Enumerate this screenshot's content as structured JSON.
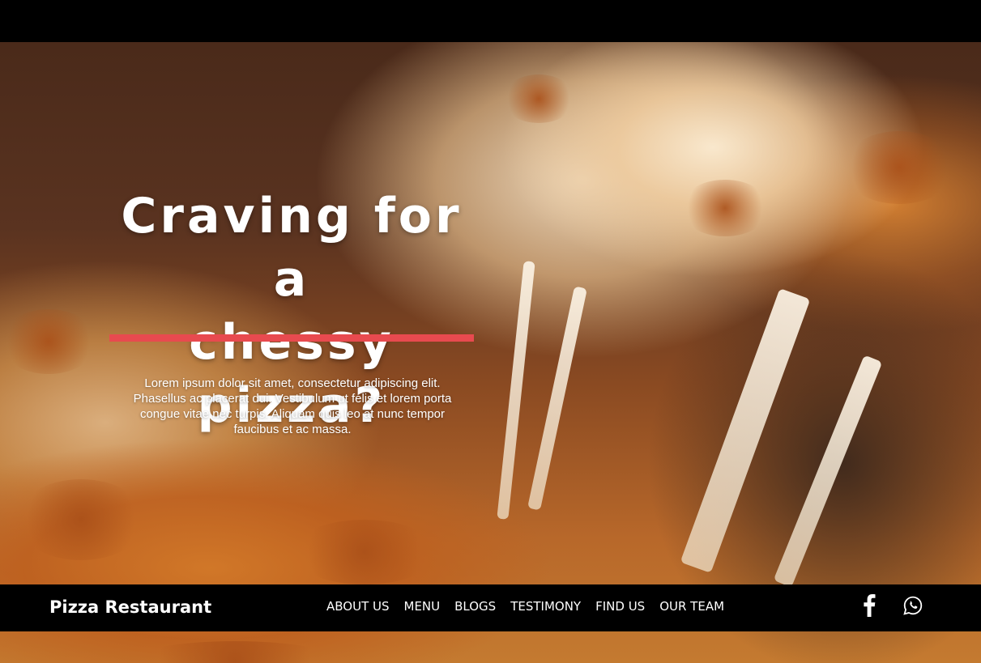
{
  "hero": {
    "title_line1": "Craving for a",
    "title_line2": "chessy pizza?",
    "description": "Lorem ipsum dolor sit amet, consectetur adipiscing elit. Phasellus ac placerat dui. Vestibulum ut felis et lorem porta congue vitae nec turpis. Aliquam quis leo at nunc tempor faucibus et ac massa.",
    "accent_color": "#e84a4f",
    "background_image": "melted-cheese-pizza-photo"
  },
  "navbar": {
    "brand": "Pizza Restaurant",
    "items": [
      {
        "label": "ABOUT US"
      },
      {
        "label": "MENU"
      },
      {
        "label": "BLOGS"
      },
      {
        "label": "TESTIMONY"
      },
      {
        "label": "FIND US"
      },
      {
        "label": "OUR TEAM"
      }
    ],
    "social": [
      {
        "icon": "facebook-icon"
      },
      {
        "icon": "whatsapp-icon"
      }
    ]
  }
}
